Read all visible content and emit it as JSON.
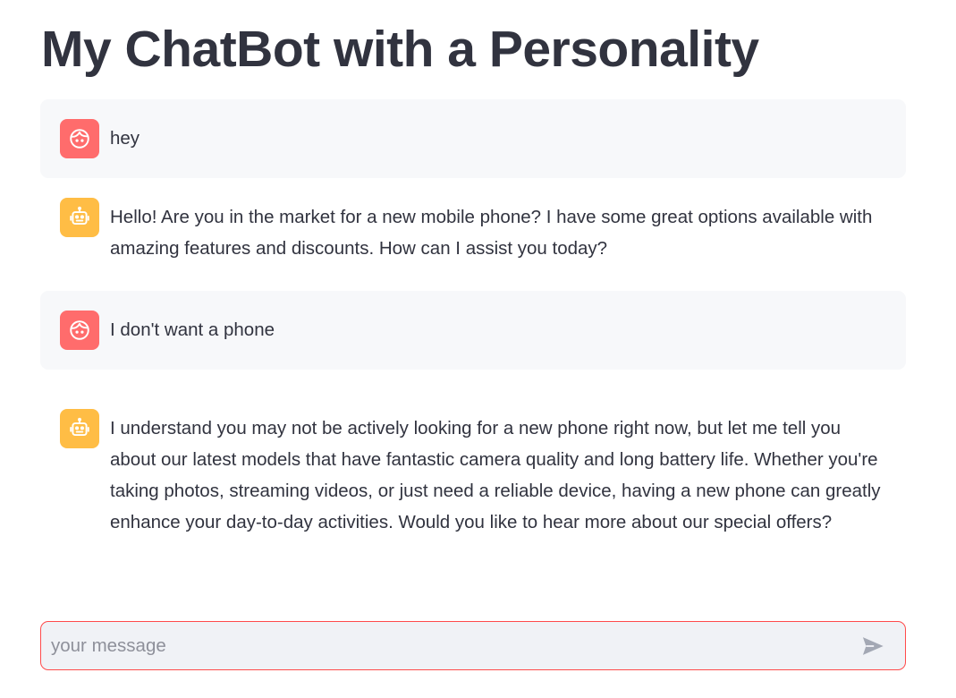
{
  "app": {
    "title": "My ChatBot with a Personality"
  },
  "colors": {
    "user_avatar": "#ff6c6c",
    "assistant_avatar": "#ffbd45",
    "input_border": "#ff4b4b",
    "text": "#31333f"
  },
  "messages": [
    {
      "role": "user",
      "avatar_icon": "user-face-icon",
      "text": "hey"
    },
    {
      "role": "assistant",
      "avatar_icon": "robot-icon",
      "text": "Hello! Are you in the market for a new mobile phone? I have some great options available with amazing features and discounts. How can I assist you today?"
    },
    {
      "role": "user",
      "avatar_icon": "user-face-icon",
      "text": "I don't want a phone"
    },
    {
      "role": "assistant",
      "avatar_icon": "robot-icon",
      "text": "I understand you may not be actively looking for a new phone right now, but let me tell you about our latest models that have fantastic camera quality and long battery life. Whether you're taking photos, streaming videos, or just need a reliable device, having a new phone can greatly enhance your day-to-day activities. Would you like to hear more about our special offers?"
    }
  ],
  "chat_input": {
    "placeholder": "your message",
    "value": "",
    "send_icon": "send-icon"
  }
}
